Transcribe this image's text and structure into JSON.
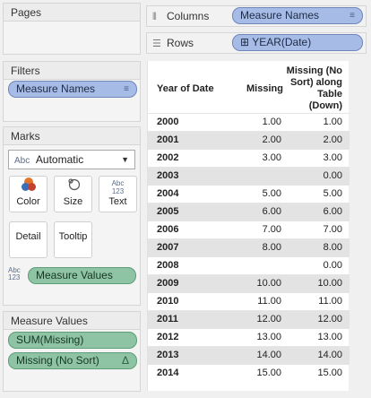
{
  "cards": {
    "pages": {
      "title": "Pages"
    },
    "filters": {
      "title": "Filters",
      "pill": "Measure Names"
    },
    "marks": {
      "title": "Marks",
      "type_prefix": "Abc",
      "type": "Automatic",
      "buttons": {
        "color": "Color",
        "size": "Size",
        "text": "Text",
        "detail": "Detail",
        "tooltip": "Tooltip"
      },
      "text_symbol_top": "Abc",
      "text_symbol_bottom": "123",
      "measure_values_prefix_top": "Abc",
      "measure_values_prefix_bottom": "123",
      "measure_values_pill": "Measure Values"
    },
    "measure_values": {
      "title": "Measure Values",
      "pills": [
        "SUM(Missing)",
        "Missing (No Sort)"
      ],
      "delta_symbol": "Δ"
    }
  },
  "shelves": {
    "columns": {
      "label": "Columns",
      "pill": "Measure Names"
    },
    "rows": {
      "label": "Rows",
      "pill": "YEAR(Date)",
      "pill_prefix": "⊞"
    }
  },
  "table": {
    "headers": {
      "year": "Year of Date",
      "missing": "Missing",
      "nosort_line1": "Missing (No",
      "nosort_line2": "Sort) along",
      "nosort_line3": "Table",
      "nosort_line4": "(Down)"
    },
    "rows": [
      {
        "year": "2000",
        "missing": "1.00",
        "nosort": "1.00"
      },
      {
        "year": "2001",
        "missing": "2.00",
        "nosort": "2.00"
      },
      {
        "year": "2002",
        "missing": "3.00",
        "nosort": "3.00"
      },
      {
        "year": "2003",
        "missing": "",
        "nosort": "0.00"
      },
      {
        "year": "2004",
        "missing": "5.00",
        "nosort": "5.00"
      },
      {
        "year": "2005",
        "missing": "6.00",
        "nosort": "6.00"
      },
      {
        "year": "2006",
        "missing": "7.00",
        "nosort": "7.00"
      },
      {
        "year": "2007",
        "missing": "8.00",
        "nosort": "8.00"
      },
      {
        "year": "2008",
        "missing": "",
        "nosort": "0.00"
      },
      {
        "year": "2009",
        "missing": "10.00",
        "nosort": "10.00"
      },
      {
        "year": "2010",
        "missing": "11.00",
        "nosort": "11.00"
      },
      {
        "year": "2011",
        "missing": "12.00",
        "nosort": "12.00"
      },
      {
        "year": "2012",
        "missing": "13.00",
        "nosort": "13.00"
      },
      {
        "year": "2013",
        "missing": "14.00",
        "nosort": "14.00"
      },
      {
        "year": "2014",
        "missing": "15.00",
        "nosort": "15.00"
      }
    ]
  }
}
